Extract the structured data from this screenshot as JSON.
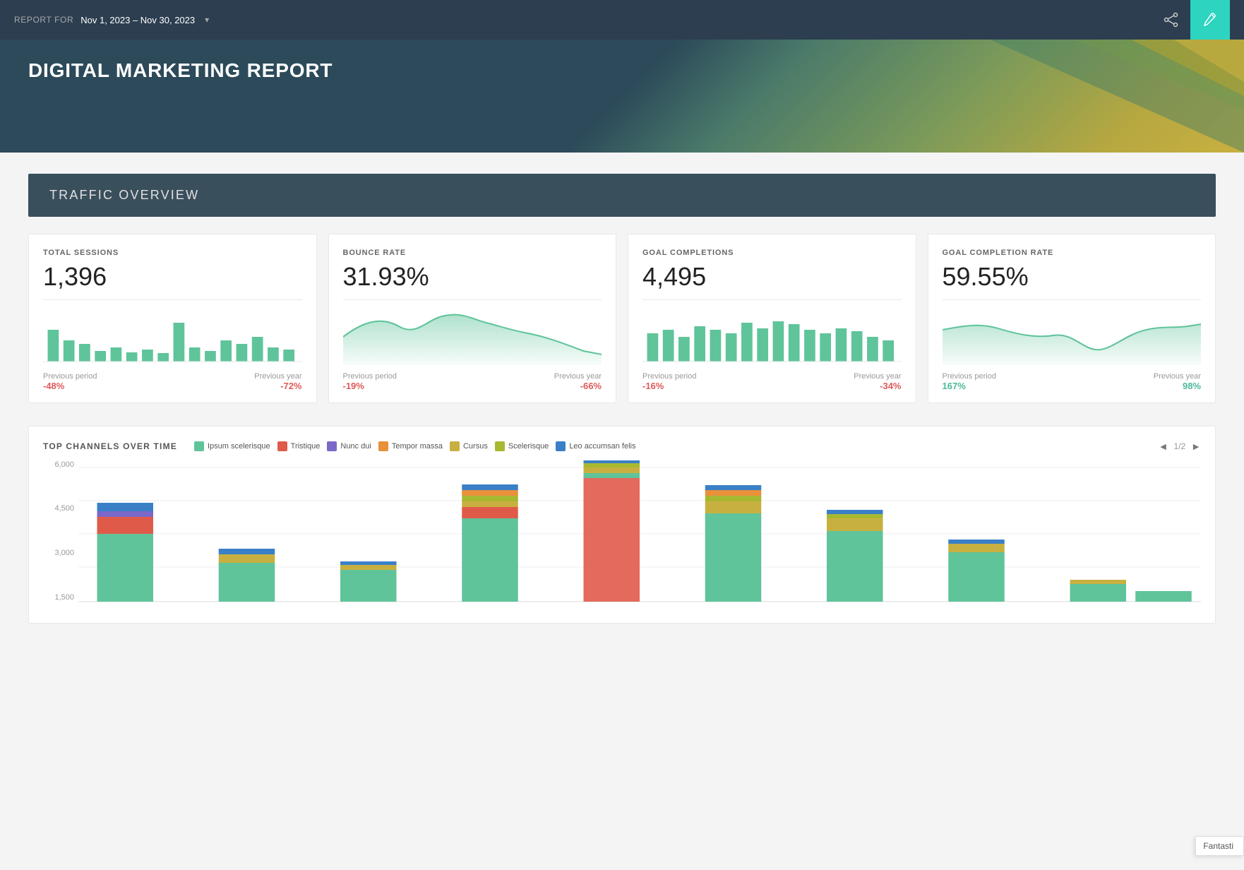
{
  "header": {
    "report_label": "REPORT FOR",
    "date_range": "Nov 1, 2023 – Nov 30, 2023",
    "chevron": "▾",
    "share_icon": "⤳",
    "edit_icon": "✎"
  },
  "hero": {
    "title": "DIGITAL MARKETING REPORT"
  },
  "traffic_overview": {
    "section_title": "TRAFFIC OVERVIEW",
    "metrics": [
      {
        "label": "TOTAL SESSIONS",
        "value": "1,396",
        "previous_period_label": "Previous period",
        "previous_year_label": "Previous year",
        "previous_period_change": "-48%",
        "previous_year_change": "-72%",
        "period_positive": false,
        "year_positive": false
      },
      {
        "label": "BOUNCE RATE",
        "value": "31.93%",
        "previous_period_label": "Previous period",
        "previous_year_label": "Previous year",
        "previous_period_change": "-19%",
        "previous_year_change": "-66%",
        "period_positive": false,
        "year_positive": false
      },
      {
        "label": "GOAL COMPLETIONS",
        "value": "4,495",
        "previous_period_label": "Previous period",
        "previous_year_label": "Previous year",
        "previous_period_change": "-16%",
        "previous_year_change": "-34%",
        "period_positive": false,
        "year_positive": false
      },
      {
        "label": "GOAL COMPLETION RATE",
        "value": "59.55%",
        "previous_period_label": "Previous period",
        "previous_year_label": "Previous year",
        "previous_period_change": "167%",
        "previous_year_change": "98%",
        "period_positive": true,
        "year_positive": true
      }
    ]
  },
  "top_channels": {
    "title": "TOP CHANNELS OVER TIME",
    "legend": [
      {
        "label": "Ipsum scelerisque",
        "color": "#5fc49a"
      },
      {
        "label": "Tristique",
        "color": "#e05a4a"
      },
      {
        "label": "Nunc dui",
        "color": "#7b68c8"
      },
      {
        "label": "Tempor massa",
        "color": "#e8903a"
      },
      {
        "label": "Cursus",
        "color": "#c8b040"
      },
      {
        "label": "Scelerisque",
        "color": "#a8b830"
      },
      {
        "label": "Leo accumsan felis",
        "color": "#3a80c8"
      }
    ],
    "pagination": "1/2",
    "y_labels": [
      "6,000",
      "4,500",
      "3,000",
      "1,500"
    ]
  },
  "fantastic": "Fantasti"
}
